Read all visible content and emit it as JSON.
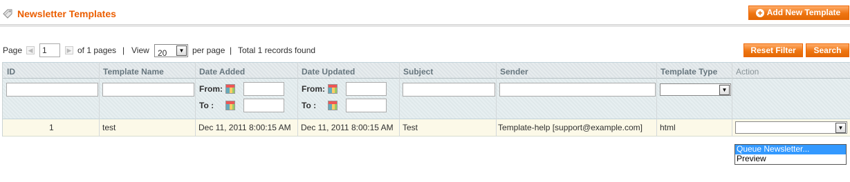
{
  "header": {
    "title": "Newsletter Templates",
    "add_button": "Add New Template",
    "icon": "tag-icon"
  },
  "pager": {
    "page_label": "Page",
    "page_value": "1",
    "of_pages": "of 1 pages",
    "sep1": "|",
    "view_label": "View",
    "per_page_value": "20",
    "per_page_label": "per page",
    "sep2": "|",
    "total": "Total 1 records found"
  },
  "actions": {
    "reset_filter": "Reset Filter",
    "search": "Search"
  },
  "grid": {
    "columns": [
      "ID",
      "Template Name",
      "Date Added",
      "Date Updated",
      "Subject",
      "Sender",
      "Template Type",
      "Action"
    ],
    "filter_labels": {
      "from": "From:",
      "to": "To :"
    },
    "rows": [
      {
        "id": "1",
        "name": "test",
        "date_added": "Dec 11, 2011 8:00:15 AM",
        "date_updated": "Dec 11, 2011 8:00:15 AM",
        "subject": "Test",
        "sender": "Template-help [support@example.com]",
        "type": "html"
      }
    ],
    "action_options": [
      "Queue Newsletter...",
      "Preview"
    ]
  },
  "colors": {
    "accent": "#eb5e00",
    "button": "#ef7512",
    "row_bg": "#fcf9e8",
    "highlight": "#3399ff"
  }
}
